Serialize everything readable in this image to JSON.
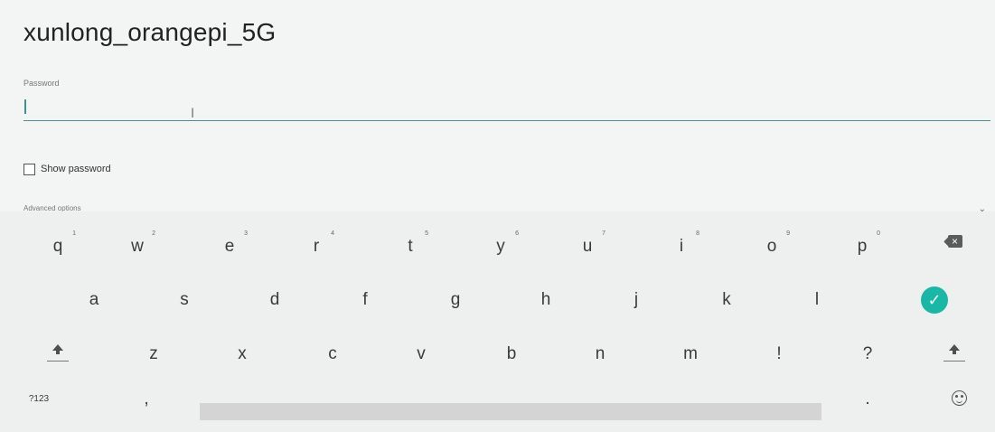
{
  "dialog": {
    "title": "xunlong_orangepi_5G",
    "password_label": "Password",
    "password_value": "",
    "show_password_label": "Show password",
    "advanced_options_label": "Advanced options"
  },
  "keyboard": {
    "row1": [
      {
        "key": "q",
        "hint": "1"
      },
      {
        "key": "w",
        "hint": "2"
      },
      {
        "key": "e",
        "hint": "3"
      },
      {
        "key": "r",
        "hint": "4"
      },
      {
        "key": "t",
        "hint": "5"
      },
      {
        "key": "y",
        "hint": "6"
      },
      {
        "key": "u",
        "hint": "7"
      },
      {
        "key": "i",
        "hint": "8"
      },
      {
        "key": "o",
        "hint": "9"
      },
      {
        "key": "p",
        "hint": "0"
      }
    ],
    "row2": [
      "a",
      "s",
      "d",
      "f",
      "g",
      "h",
      "j",
      "k",
      "l"
    ],
    "row3": [
      "z",
      "x",
      "c",
      "v",
      "b",
      "n",
      "m",
      "!",
      "?"
    ],
    "bottom": {
      "symbols": "?123",
      "comma": ",",
      "period": "."
    },
    "icons": {
      "backspace": "backspace-icon",
      "done": "done-check-icon",
      "shift_left": "shift-left-icon",
      "shift_right": "shift-right-icon",
      "emoji": "emoji-icon"
    },
    "colors": {
      "accent": "#19b7a5",
      "field_line": "#4d8d91"
    }
  }
}
